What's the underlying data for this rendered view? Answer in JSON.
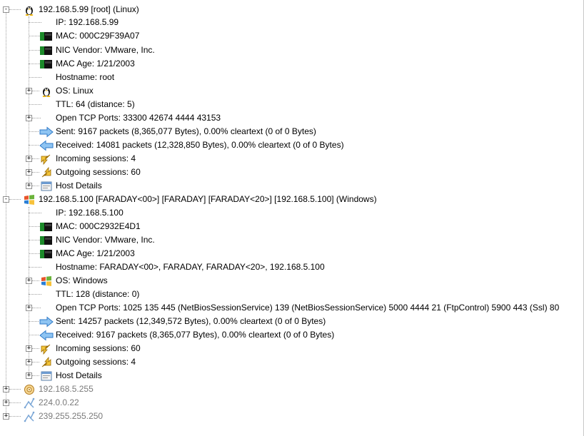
{
  "hosts": [
    {
      "title": "192.168.5.99 [root] (Linux)",
      "ip": "IP: 192.168.5.99",
      "mac": "MAC: 000C29F39A07",
      "nic_vendor": "NIC Vendor: VMware, Inc.",
      "mac_age": "MAC Age: 1/21/2003",
      "hostname": "Hostname: root",
      "os": "OS: Linux",
      "ttl": "TTL: 64 (distance: 5)",
      "open_tcp": "Open TCP Ports: 33300 42674 4444 43153",
      "sent": "Sent: 9167 packets (8,365,077 Bytes), 0.00% cleartext (0 of 0 Bytes)",
      "received": "Received: 14081 packets (12,328,850 Bytes), 0.00% cleartext (0 of 0 Bytes)",
      "incoming": "Incoming sessions: 4",
      "outgoing": "Outgoing sessions: 60",
      "details": "Host Details"
    },
    {
      "title": "192.168.5.100 [FARADAY<00>] [FARADAY] [FARADAY<20>] [192.168.5.100] (Windows)",
      "ip": "IP: 192.168.5.100",
      "mac": "MAC: 000C2932E4D1",
      "nic_vendor": "NIC Vendor: VMware, Inc.",
      "mac_age": "MAC Age: 1/21/2003",
      "hostname": "Hostname: FARADAY<00>, FARADAY, FARADAY<20>, 192.168.5.100",
      "os": "OS: Windows",
      "ttl": "TTL: 128 (distance: 0)",
      "open_tcp": "Open TCP Ports: 1025 135 445 (NetBiosSessionService) 139 (NetBiosSessionService) 5000 4444 21 (FtpControl) 5900 443 (Ssl) 80",
      "sent": "Sent: 14257 packets (12,349,572 Bytes), 0.00% cleartext (0 of 0 Bytes)",
      "received": "Received: 9167 packets (8,365,077 Bytes), 0.00% cleartext (0 of 0 Bytes)",
      "incoming": "Incoming sessions: 60",
      "outgoing": "Outgoing sessions: 4",
      "details": "Host Details"
    }
  ],
  "other_hosts": [
    "192.168.5.255",
    "224.0.0.22",
    "239.255.255.250"
  ],
  "expander": {
    "collapsed": "+",
    "expanded": "-"
  },
  "icons": {
    "linux": "tux-penguin-icon",
    "windows": "windows-flag-icon",
    "nic": "network-card-icon",
    "sent": "blue-right-arrow-icon",
    "received": "blue-left-arrow-icon",
    "incoming": "yellow-arrow-in-icon",
    "outgoing": "yellow-arrow-out-icon",
    "details": "window-details-icon",
    "broadcast": "broadcast-icon",
    "multicast": "multicast-icon"
  },
  "colors": {
    "tree_line": "#a0a0a0",
    "greyed_text": "#7a7a7a",
    "arrow_blue": "#4a90d9",
    "arrow_yellow": "#e8b020"
  }
}
